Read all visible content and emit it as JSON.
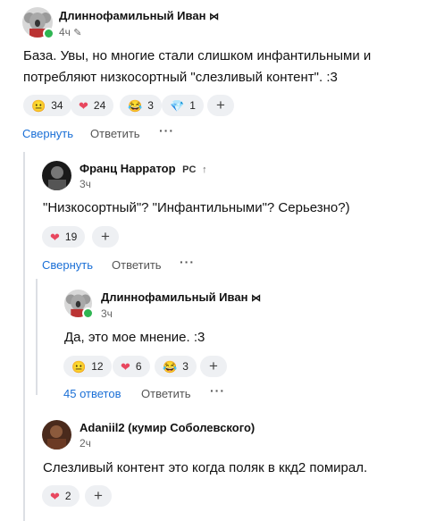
{
  "comments": [
    {
      "author": "Длиннофамильный Иван",
      "time": "4ч",
      "text": "База. Увы, но многие стали слишком инфантильными и потребляют низкосортный \"слезливый контент\". :3",
      "reactions": [
        {
          "emoji": "😐",
          "count": "34"
        },
        {
          "emoji": "❤",
          "count": "24"
        },
        {
          "emoji": "😂",
          "count": "3"
        },
        {
          "emoji": "💎",
          "count": "1"
        }
      ],
      "actions": {
        "collapse": "Свернуть",
        "reply": "Ответить"
      }
    },
    {
      "author": "Франц Нарратор",
      "badge": "PC",
      "time": "3ч",
      "text": "\"Низкосортный\"? \"Инфантильными\"? Серьезно?)",
      "reactions": [
        {
          "emoji": "❤",
          "count": "19"
        }
      ],
      "actions": {
        "collapse": "Свернуть",
        "reply": "Ответить"
      }
    },
    {
      "author": "Длиннофамильный Иван",
      "time": "3ч",
      "text": "Да, это мое мнение. :3",
      "reactions": [
        {
          "emoji": "😐",
          "count": "12"
        },
        {
          "emoji": "❤",
          "count": "6"
        },
        {
          "emoji": "😂",
          "count": "3"
        }
      ],
      "actions": {
        "replies": "45 ответов",
        "reply": "Ответить"
      }
    },
    {
      "author": "Adaniil2 (кумир Соболевского)",
      "time": "2ч",
      "text": "Слезливый контент это когда поляк в ккд2 помирал.",
      "reactions": [
        {
          "emoji": "❤",
          "count": "2"
        }
      ]
    }
  ],
  "icons": {
    "edit": "pencil-icon",
    "bowtie": "bowtie-icon",
    "upvote": "arrow-up-icon",
    "add_reaction": "plus-icon",
    "more": "more-dots-icon"
  },
  "colors": {
    "link": "#1a6fd6",
    "online": "#2fb552",
    "heart": "#e8475f"
  }
}
